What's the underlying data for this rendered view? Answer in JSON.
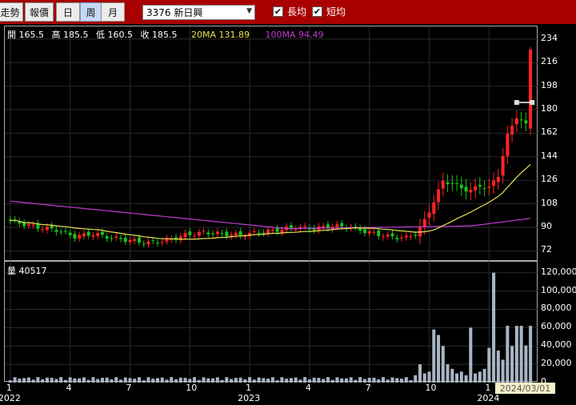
{
  "toolbar": {
    "buttons": [
      {
        "label": "走勢",
        "active": false
      },
      {
        "label": "報價",
        "active": false
      },
      {
        "label": "日",
        "active": false
      },
      {
        "label": "周",
        "active": true
      },
      {
        "label": "月",
        "active": false
      }
    ],
    "stock_select": "3376 新日興",
    "long_ma_checkbox": {
      "checked": true,
      "label": "長均"
    },
    "short_ma_checkbox": {
      "checked": true,
      "label": "短均"
    }
  },
  "price_header": {
    "open": "開 165.5",
    "high": "高 185.5",
    "low": "低 160.5",
    "close": "收 185.5",
    "ma20": "20MA 131.89",
    "ma100": "100MA 94.49"
  },
  "volume_header": "量 40517",
  "colors": {
    "up": "#ff2424",
    "down": "#17c417",
    "ma20": "#e7e252",
    "ma100": "#c23bd0",
    "volume": "#a9b5c4"
  },
  "price_axis": {
    "ticks": [
      "234",
      "216",
      "198",
      "180",
      "162",
      "144",
      "126",
      "108",
      "90",
      "72"
    ]
  },
  "volume_axis": {
    "ticks": [
      "120,000",
      "100,000",
      "80,000",
      "60,000",
      "40,000",
      "20,000",
      "0"
    ]
  },
  "time_axis": {
    "months": [
      "1",
      "4",
      "7",
      "10",
      "1",
      "4",
      "7",
      "10",
      "1"
    ],
    "years": [
      "2022",
      "2023",
      "2024"
    ]
  },
  "cursor_date": "2024/03/01",
  "chart_data": {
    "type": "candlestick",
    "price_range": [
      60,
      240
    ],
    "volume_range": [
      0,
      125000
    ],
    "candles": [],
    "ma20": [],
    "ma100": [],
    "volume": []
  }
}
